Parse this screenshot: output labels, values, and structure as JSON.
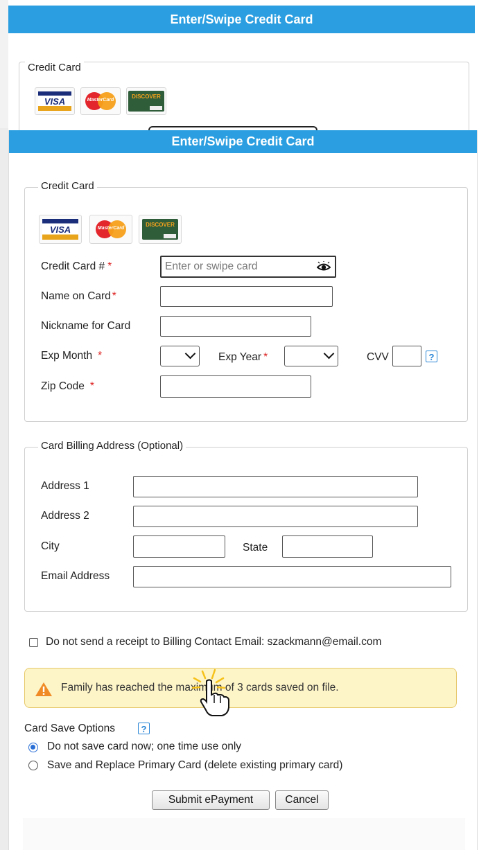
{
  "bg_dialog": {
    "title": "Enter/Swipe Credit Card",
    "legend": "Credit Card"
  },
  "dialog": {
    "title": "Enter/Swipe Credit Card"
  },
  "credit_card": {
    "legend": "Credit Card",
    "card_logos": [
      "VISA",
      "MasterCard",
      "DISCOVER"
    ],
    "card_number_label": "Credit Card #",
    "card_number_placeholder": "Enter or swipe card",
    "name_label": "Name on Card",
    "nickname_label": "Nickname for Card",
    "exp_month_label": "Exp Month",
    "exp_year_label": "Exp Year",
    "cvv_label": "CVV",
    "zip_label": "Zip Code",
    "required_mark": "*"
  },
  "billing": {
    "legend": "Card Billing Address (Optional)",
    "address1_label": "Address 1",
    "address2_label": "Address 2",
    "city_label": "City",
    "state_label": "State",
    "email_label": "Email Address"
  },
  "receipt_checkbox_label": "Do not send a receipt to Billing Contact Email: szackmann@email.com",
  "warning_text": "Family has reached the maximum of 3 cards saved on file.",
  "card_save": {
    "label": "Card Save Options",
    "options": [
      "Do not save card now; one time use only",
      "Save and Replace Primary Card (delete existing primary card)"
    ],
    "selected_index": 0
  },
  "buttons": {
    "submit": "Submit ePayment",
    "cancel": "Cancel"
  },
  "colors": {
    "titlebar": "#2a9ee0",
    "warning_bg": "#fdf4c8",
    "required": "#d22222"
  }
}
